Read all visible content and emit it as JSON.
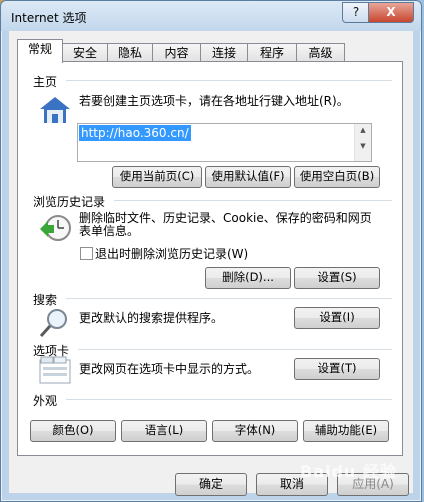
{
  "window": {
    "title": "Internet 选项",
    "help": "?",
    "close": "X"
  },
  "tabs": [
    {
      "label": "常规"
    },
    {
      "label": "安全"
    },
    {
      "label": "隐私"
    },
    {
      "label": "内容"
    },
    {
      "label": "连接"
    },
    {
      "label": "程序"
    },
    {
      "label": "高级"
    }
  ],
  "home": {
    "label": "主页",
    "description": "若要创建主页选项卡，请在各地址行键入地址(R)。",
    "url": "http://hao.360.cn/",
    "btn_current": "使用当前页(C)",
    "btn_default": "使用默认值(F)",
    "btn_blank": "使用空白页(B)"
  },
  "history": {
    "label": "浏览历史记录",
    "description_line1": "删除临时文件、历史记录、Cookie、保存的密码和网页",
    "description_line2": "表单信息。",
    "checkbox_label": "退出时删除浏览历史记录(W)",
    "btn_delete": "删除(D)...",
    "btn_settings": "设置(S)"
  },
  "search": {
    "label": "搜索",
    "description": "更改默认的搜索提供程序。",
    "btn_settings": "设置(I)"
  },
  "tabs_section": {
    "label": "选项卡",
    "description": "更改网页在选项卡中显示的方式。",
    "btn_settings": "设置(T)"
  },
  "appearance": {
    "label": "外观",
    "btn_colors": "颜色(O)",
    "btn_languages": "语言(L)",
    "btn_fonts": "字体(N)",
    "btn_accessibility": "辅助功能(E)"
  },
  "footer": {
    "ok": "确定",
    "cancel": "取消",
    "apply": "应用(A)"
  },
  "watermark": "Baidu 经验"
}
